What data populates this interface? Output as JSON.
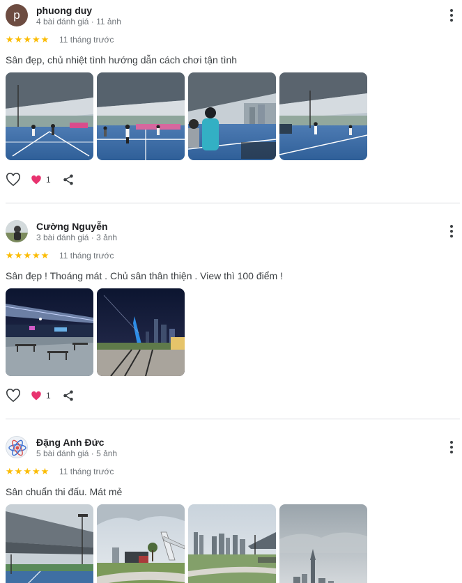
{
  "reviews": [
    {
      "name": "phuong duy",
      "avatar_letter": "p",
      "meta": "4 bài đánh giá · 11 ảnh",
      "rating": 5,
      "when": "11 tháng trước",
      "text": "Sân đẹp, chủ nhiệt tình hướng dẫn cách chơi tận tình",
      "photos": [
        "covered-court-photo",
        "covered-court-photo",
        "player-photo",
        "covered-court-photo"
      ],
      "likes": "1"
    },
    {
      "name": "Cường Nguyễn",
      "avatar_letter": "",
      "meta": "3 bài đánh giá · 3 ảnh",
      "rating": 5,
      "when": "11 tháng trước",
      "text": "Sân đẹp ! Thoáng mát . Chủ sân thân thiện . View thì 100 điểm !",
      "photos": [
        "night-court-photo",
        "night-city-photo"
      ],
      "likes": "1"
    },
    {
      "name": "Đặng Anh Đức",
      "avatar_letter": "",
      "meta": "5 bài đánh giá · 5 ảnh",
      "rating": 5,
      "when": "11 tháng trước",
      "text": "Sân chuẩn thi đấu. Mát mẻ",
      "photos": [
        "court-roof-photo",
        "park-bridge-photo",
        "city-skyline-photo",
        "cloudy-tower-photo"
      ],
      "likes": ""
    }
  ],
  "icons": {
    "more": "more-vert-icon",
    "star": "star-icon",
    "like": "heart-outline-icon",
    "reaction": "heart-filled-icon",
    "share": "share-icon"
  },
  "colors": {
    "star": "#fbbc04",
    "heart": "#e8336f",
    "text": "#3c4043",
    "meta": "#70757a",
    "divider": "#dadce0"
  }
}
